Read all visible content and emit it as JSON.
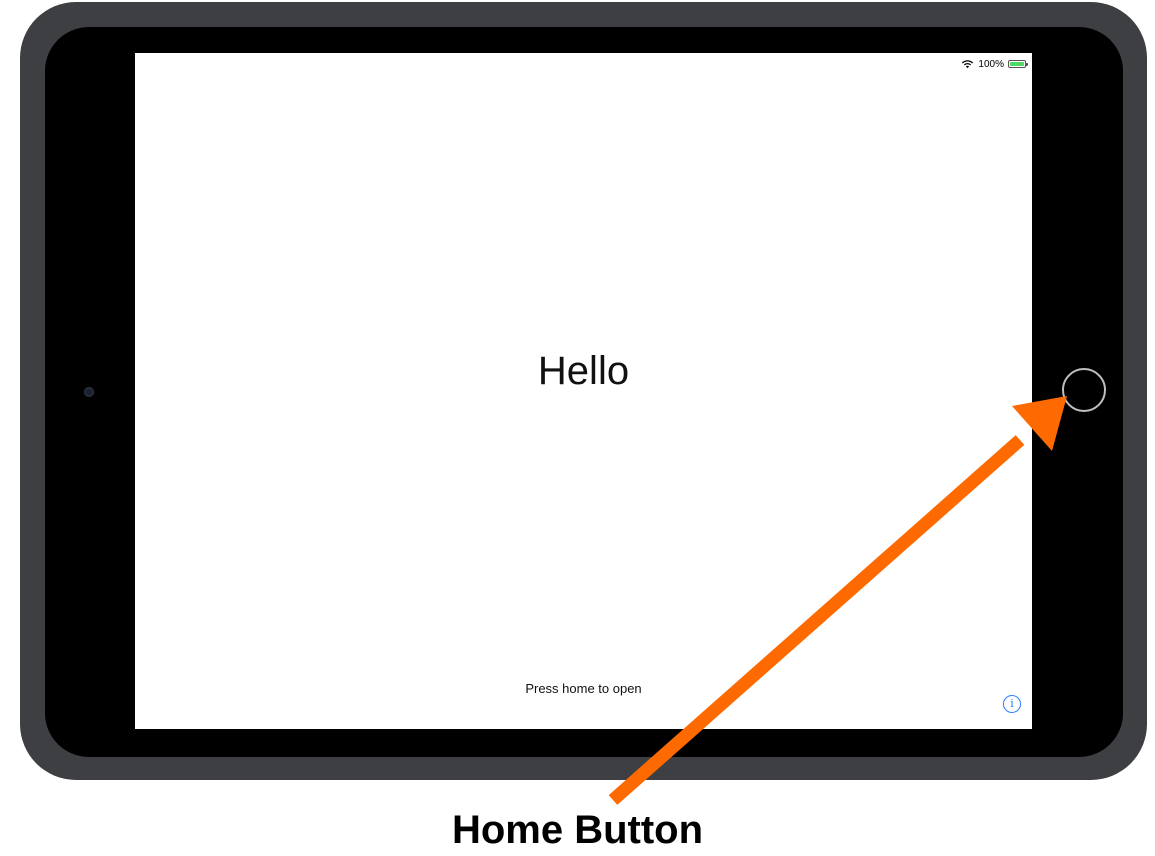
{
  "status_bar": {
    "battery_text": "100%",
    "wifi_icon": "wifi-icon",
    "battery_icon": "battery-icon",
    "battery_level": 1.0,
    "battery_color": "#4cd964"
  },
  "screen": {
    "greeting": "Hello",
    "hint": "Press home to open",
    "info_icon_glyph": "i"
  },
  "device": {
    "frame_color": "#3e3f43",
    "home_button": "home-button"
  },
  "annotation": {
    "label": "Home Button",
    "arrow_color": "#ff6a00"
  }
}
